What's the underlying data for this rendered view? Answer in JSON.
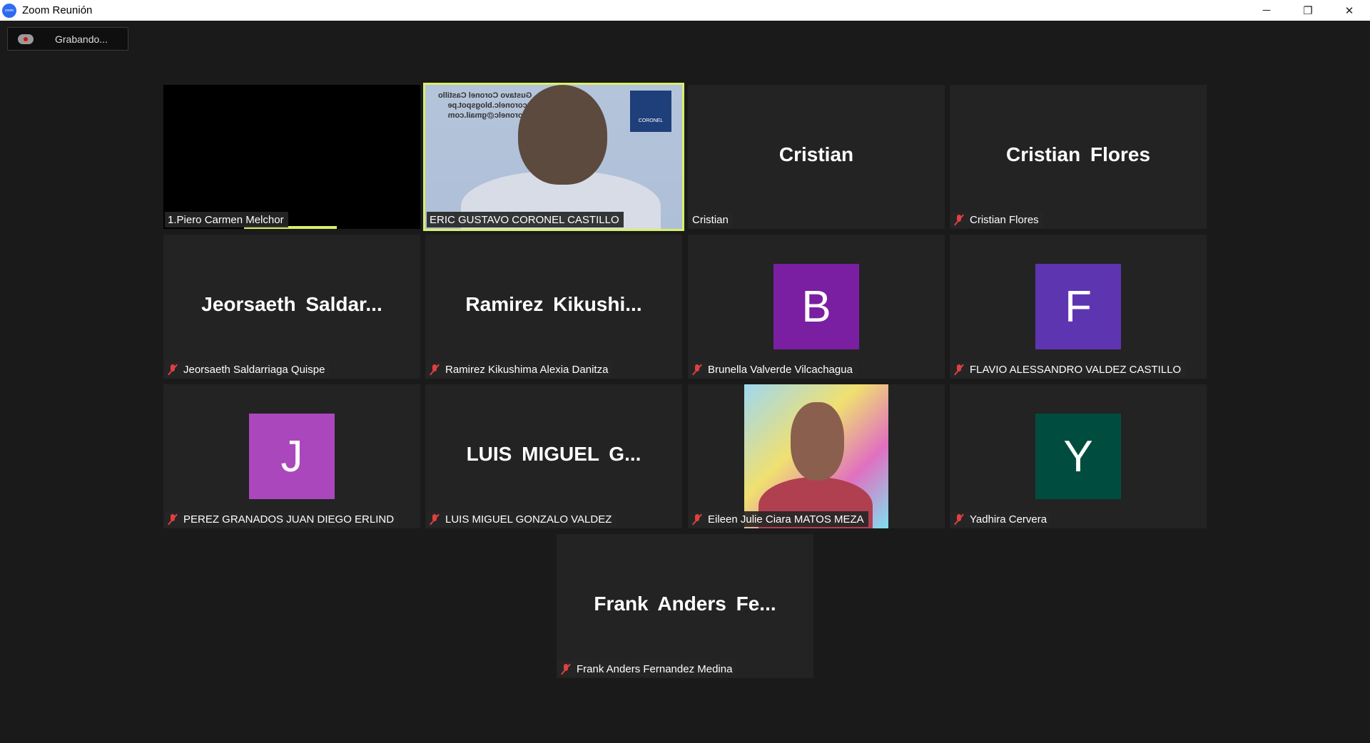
{
  "window": {
    "title": "Zoom Reunión",
    "app_icon": "zoom",
    "controls": {
      "minimize": "─",
      "restore": "❐",
      "close": "✕"
    }
  },
  "recording": {
    "label": "Grabando...",
    "icon": "cloud-record-icon",
    "dot_color": "#e01010"
  },
  "participants": [
    {
      "display": "",
      "name": "1.Piero Carmen Melchor",
      "muted": false,
      "video": true,
      "speaking_indicator": true
    },
    {
      "display": "",
      "name": "ERIC GUSTAVO CORONEL CASTILLO",
      "muted": false,
      "video": true,
      "active_speaker": true,
      "video_overlay": {
        "lines": [
          "Gustavo Coronel Castillo",
          "gcoronelc.blogspot.pe",
          "gcoronelc@gmail.com"
        ],
        "logo": "CORONEL"
      }
    },
    {
      "display": "Cristian",
      "name": "Cristian",
      "muted": false
    },
    {
      "display": "Cristian Flores",
      "name": "Cristian Flores",
      "muted": true
    },
    {
      "display": "Jeorsaeth  Saldar...",
      "name": "Jeorsaeth Saldarriaga Quispe",
      "muted": true
    },
    {
      "display": "Ramirez  Kikushi...",
      "name": "Ramirez Kikushima Alexia Danitza",
      "muted": true
    },
    {
      "display": "B",
      "name": "Brunella Valverde Vilcachagua",
      "muted": true,
      "avatar_color": "#7b1fa2"
    },
    {
      "display": "F",
      "name": "FLAVIO ALESSANDRO VALDEZ CASTILLO",
      "muted": true,
      "avatar_color": "#5e35b1"
    },
    {
      "display": "J",
      "name": "PEREZ GRANADOS JUAN DIEGO ERLIND",
      "muted": true,
      "avatar_color": "#ab47bc"
    },
    {
      "display": "LUIS  MIGUEL  G...",
      "name": "LUIS MIGUEL GONZALO VALDEZ",
      "muted": true
    },
    {
      "display": "",
      "name": "Eileen Julie Ciara MATOS MEZA",
      "muted": true,
      "video": true
    },
    {
      "display": "Y",
      "name": "Yadhira Cervera",
      "muted": true,
      "avatar_color": "#004d40"
    },
    {
      "display": "Frank  Anders  Fe...",
      "name": "Frank Anders Fernandez Medina",
      "muted": true
    }
  ],
  "colors": {
    "background": "#1a1a1a",
    "tile": "#232323",
    "active_border": "#d8ef6a",
    "muted_icon": "#e04040"
  }
}
